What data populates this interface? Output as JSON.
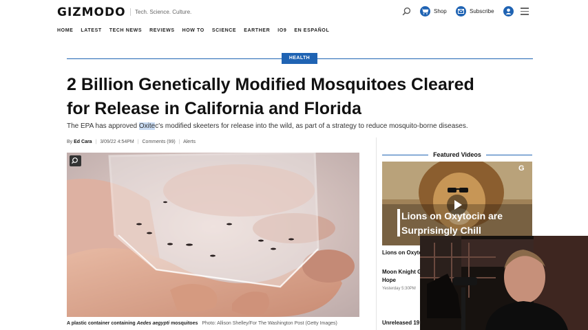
{
  "header": {
    "logo": "GIZMODO",
    "tagline": "Tech. Science. Culture.",
    "shop_label": "Shop",
    "subscribe_label": "Subscribe"
  },
  "nav": [
    "HOME",
    "LATEST",
    "TECH NEWS",
    "REVIEWS",
    "HOW TO",
    "SCIENCE",
    "EARTHER",
    "IO9",
    "EN ESPAÑOL"
  ],
  "article": {
    "category": "HEALTH",
    "headline": "2 Billion Genetically Modified Mosquitoes Cleared for Release in California and Florida",
    "dek_before": "The EPA has approved ",
    "dek_highlight": "Oxite",
    "dek_after": "c's modified skeeters for release into the wild, as part of a strategy to reduce mosquito-borne diseases.",
    "byline_prefix": "By",
    "author": "Ed Cara",
    "timestamp": "3/09/22 4:54PM",
    "comments": "Comments (99)",
    "alerts": "Alerts",
    "caption_prefix": "A plastic container containing ",
    "caption_species": "Aedes aegypti",
    "caption_suffix": " mosquitoes",
    "photo_credit": "Photo: Allison Shelley/For The Washington Post (Getty Images)"
  },
  "sidebar": {
    "featured_title": "Featured Videos",
    "video_caption_line1": "Lions on Oxytocin are",
    "video_caption_line2": "Surprisingly Chill",
    "video_badge": "G",
    "items": [
      {
        "title": "Lions on Oxyto"
      },
      {
        "title_line1": "Moon Knight G",
        "title_line2": "Hope",
        "time": "Yesterday 5:30PM"
      },
      {
        "title": "Unreleased 19"
      }
    ]
  },
  "colors": {
    "accent": "#1f63b3"
  }
}
